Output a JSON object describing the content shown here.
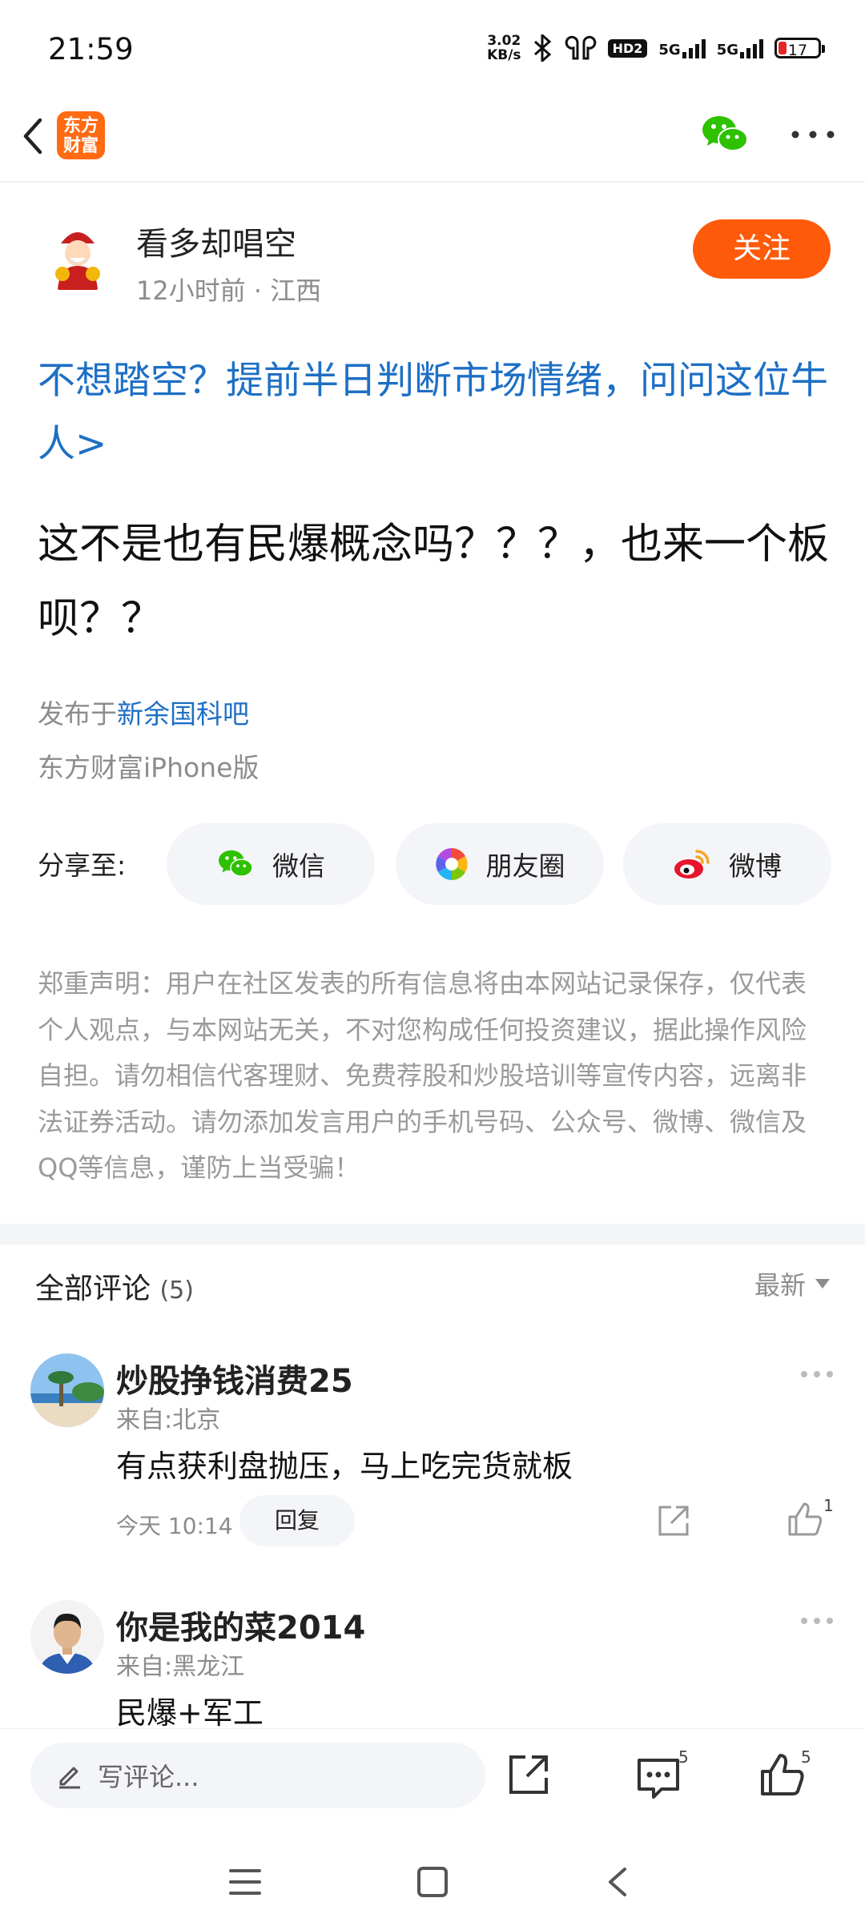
{
  "status": {
    "time": "21:59",
    "net_speed_value": "3.02",
    "net_speed_unit": "KB/s",
    "hd_label": "HD2",
    "sim1_label": "5G",
    "sim2_label": "5G",
    "battery": "17",
    "battery_color": "#e12727"
  },
  "nav": {
    "logo_line1": "东方",
    "logo_line2": "财富",
    "brand_color": "#ff6a13"
  },
  "author": {
    "name": "看多却唱空",
    "meta": "12小时前 · 江西",
    "follow_label": "关注"
  },
  "post": {
    "promo_link": "不想踏空？提前半日判断市场情绪，问问这位牛人>",
    "body": "这不是也有民爆概念吗？？？，也来一个板呗？？",
    "posted_in_prefix": "发布于",
    "forum": "新余国科吧",
    "client": "东方财富iPhone版"
  },
  "share": {
    "label": "分享至:",
    "buttons": [
      {
        "label": "微信",
        "icon": "wechat-icon"
      },
      {
        "label": "朋友圈",
        "icon": "moments-icon"
      },
      {
        "label": "微博",
        "icon": "weibo-icon"
      }
    ]
  },
  "disclaimer": "郑重声明：用户在社区发表的所有信息将由本网站记录保存，仅代表个人观点，与本网站无关，不对您构成任何投资建议，据此操作风险自担。请勿相信代客理财、免费荐股和炒股培训等宣传内容，远离非法证券活动。请勿添加发言用户的手机号码、公众号、微博、微信及QQ等信息，谨防上当受骗！",
  "comments": {
    "title": "全部评论",
    "count": "(5)",
    "sort": "最新",
    "items": [
      {
        "name": "炒股挣钱消费25",
        "location": "来自:北京",
        "text": "有点获利盘抛压，马上吃完货就板",
        "time": "今天 10:14",
        "reply": "回复",
        "likes": "1"
      },
      {
        "name": "你是我的菜2014",
        "location": "来自:黑龙江",
        "text": "民爆+军工"
      }
    ]
  },
  "bottom": {
    "input_placeholder": "写评论...",
    "comment_count": "5",
    "like_count": "5"
  }
}
